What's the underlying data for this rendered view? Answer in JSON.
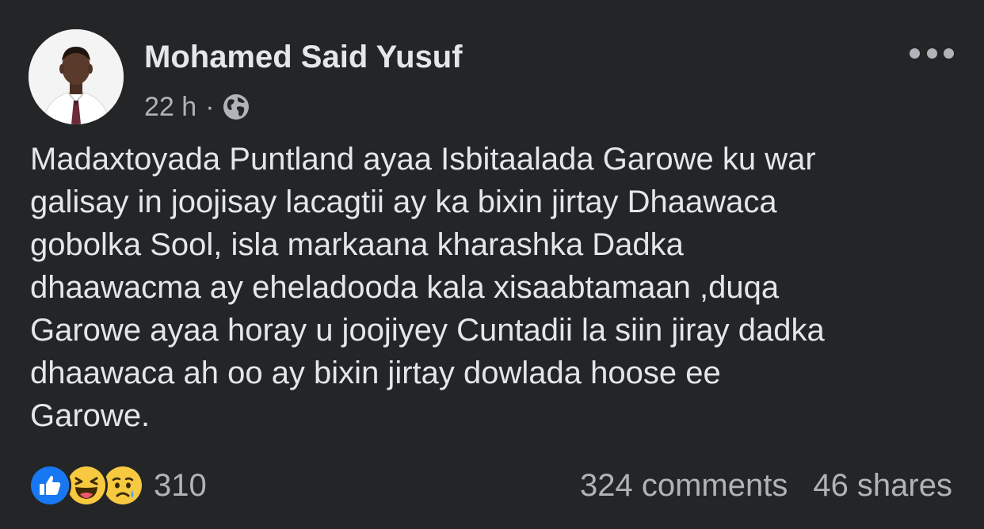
{
  "post": {
    "author": "Mohamed Said Yusuf",
    "time": "22 h",
    "separator": "·",
    "privacy_icon": "globe-icon",
    "more_icon": "more-options-icon",
    "text": "Madaxtoyada Puntland ayaa Isbitaalada Garowe ku war\ngalisay in joojisay lacagtii ay ka bixin jirtay Dhaawaca\ngobolka Sool, isla markaana kharashka Dadka\ndhaawacma ay  eheladooda kala xisaabtamaan ,duqa\nGarowe ayaa horay u joojiyey Cuntadii la siin jiray dadka\ndhaawaca ah oo ay bixin jirtay dowlada hoose ee\nGarowe."
  },
  "reactions": {
    "icons": [
      "like-reaction-icon",
      "haha-reaction-icon",
      "sad-reaction-icon"
    ],
    "count": "310"
  },
  "stats": {
    "comments": "324 comments",
    "shares": "46 shares"
  },
  "colors": {
    "background": "#242526",
    "primary_text": "#e4e6eb",
    "secondary_text": "#b0b3b8",
    "like_blue": "#1877f2",
    "emoji_yellow": "#f7c940"
  }
}
